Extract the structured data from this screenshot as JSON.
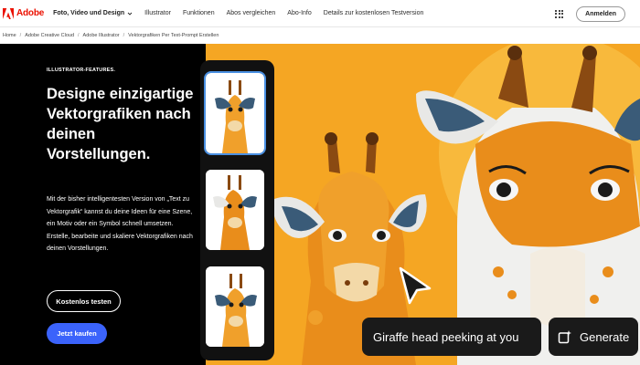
{
  "nav": {
    "brand": "Adobe",
    "items": [
      {
        "label": "Foto, Video und Design"
      },
      {
        "label": "Illustrator"
      },
      {
        "label": "Funktionen"
      },
      {
        "label": "Abos vergleichen"
      },
      {
        "label": "Abo-Info"
      },
      {
        "label": "Details zur kostenlosen Testversion"
      }
    ],
    "login_label": "Anmelden"
  },
  "breadcrumb": [
    "Home",
    "Adobe Creative Cloud",
    "Adobe Illustrator",
    "Vektorgrafiken Per Text-Prompt Erstellen"
  ],
  "hero": {
    "eyebrow": "ILLUSTRATOR-FEATURES.",
    "headline": "Designe einzigartige Vektorgrafiken nach deinen Vorstellungen.",
    "body": "Mit der bisher intelligentesten Version von „Text zu Vektorgrafik“ kannst du deine Ideen für eine Szene, ein Motiv oder ein Symbol schnell umsetzen. Erstelle, bearbeite und skaliere Vektorgrafiken nach deinen Vorstellungen.",
    "trial_label": "Kostenlos testen",
    "buy_label": "Jetzt kaufen"
  },
  "prompt": {
    "text": "Giraffe head peeking at you",
    "generate_label": "Generate"
  },
  "colors": {
    "adobe_red": "#eb1000",
    "hero_orange": "#f5a623",
    "buy_blue": "#3b63fb",
    "panel_black": "#000000"
  },
  "icons": [
    "adobe-logo-icon",
    "chevron-down-icon",
    "app-grid-icon",
    "cursor-arrow-icon",
    "generate-sparkle-icon"
  ]
}
